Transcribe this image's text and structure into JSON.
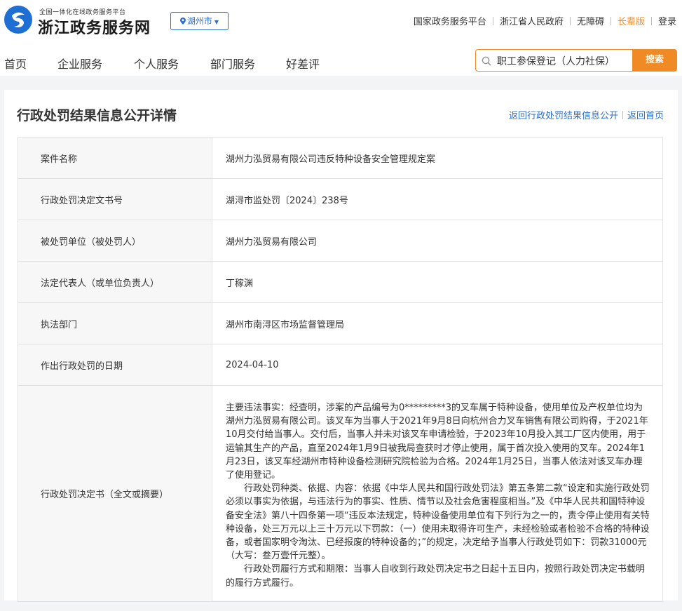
{
  "header": {
    "brand_sub": "全国一体化在线政务服务平台",
    "brand_main": "浙江政务服务网",
    "city": "湖州市",
    "links": [
      "国家政务服务平台",
      "浙江省人民政府",
      "无障碍",
      "长辈版",
      "登录"
    ]
  },
  "nav": [
    "首页",
    "企业服务",
    "个人服务",
    "部门服务",
    "好差评"
  ],
  "search": {
    "value": "职工参保登记（人力社保）",
    "button": "搜索"
  },
  "page": {
    "title": "行政处罚结果信息公开详情",
    "back_list": "返回行政处罚结果信息公开",
    "back_home": "返回首页"
  },
  "rows": [
    {
      "label": "案件名称",
      "value": "湖州力泓贸易有限公司违反特种设备安全管理规定案"
    },
    {
      "label": "行政处罚决定文书号",
      "value": "湖浔市监处罚〔2024〕238号"
    },
    {
      "label": "被处罚单位（被处罚人）",
      "value": "湖州力泓贸易有限公司"
    },
    {
      "label": "法定代表人（或单位负责人）",
      "value": "丁稼渊"
    },
    {
      "label": "执法部门",
      "value": "湖州市南浔区市场监督管理局"
    },
    {
      "label": "作出行政处罚的日期",
      "value": "2024-04-10"
    }
  ],
  "decision": {
    "label": "行政处罚决定书（全文或摘要）",
    "paragraphs": [
      "主要违法事实：经查明，涉案的产品编号为0*********3的叉车属于特种设备，使用单位及产权单位均为湖州力泓贸易有限公司。该叉车为当事人于2021年9月8日向杭州合力叉车销售有限公司购得，于2021年10月交付给当事人。交付后，当事人并未对该叉车申请检验，于2023年10月投入其工厂区内使用，用于运输其生产的产品，直至2024年1月9日被我局查获时才停止使用，属于首次投入使用的叉车。2024年1月23日，该叉车经湖州市特种设备检测研究院检验为合格。2024年1月25日，当事人依法对该叉车办理了使用登记。",
      "行政处罚种类、依据、内容：依据《中华人民共和国行政处罚法》第五条第二款“设定和实施行政处罚必须以事实为依据，与违法行为的事实、性质、情节以及社会危害程度相当。”及《中华人民共和国特种设备安全法》第八十四条第一项“违反本法规定，特种设备使用单位有下列行为之一的，责令停止使用有关特种设备，处三万元以上三十万元以下罚款：（一）使用未取得许可生产，未经检验或者检验不合格的特种设备，或者国家明令淘汰、已经报废的特种设备的；”的规定，决定给予当事人行政处罚如下：罚款31000元（大写：叁万壹仟元整）。",
      "行政处罚履行方式和期限：当事人自收到行政处罚决定书之日起十五日内，按照行政处罚决定书载明的履行方式履行。"
    ]
  },
  "colors": {
    "brand_blue": "#1f6ed4",
    "link_blue": "#2b6fce",
    "accent_orange": "#f08a24"
  }
}
